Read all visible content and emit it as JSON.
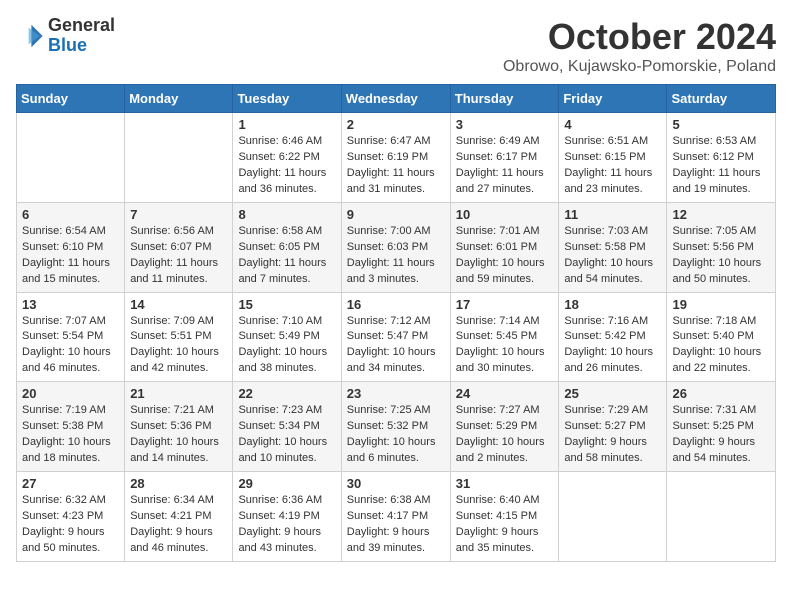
{
  "header": {
    "logo": {
      "general": "General",
      "blue": "Blue"
    },
    "title": "October 2024",
    "location": "Obrowo, Kujawsko-Pomorskie, Poland"
  },
  "days_of_week": [
    "Sunday",
    "Monday",
    "Tuesday",
    "Wednesday",
    "Thursday",
    "Friday",
    "Saturday"
  ],
  "weeks": [
    [
      {
        "day": "",
        "info": ""
      },
      {
        "day": "",
        "info": ""
      },
      {
        "day": "1",
        "info": "Sunrise: 6:46 AM\nSunset: 6:22 PM\nDaylight: 11 hours and 36 minutes."
      },
      {
        "day": "2",
        "info": "Sunrise: 6:47 AM\nSunset: 6:19 PM\nDaylight: 11 hours and 31 minutes."
      },
      {
        "day": "3",
        "info": "Sunrise: 6:49 AM\nSunset: 6:17 PM\nDaylight: 11 hours and 27 minutes."
      },
      {
        "day": "4",
        "info": "Sunrise: 6:51 AM\nSunset: 6:15 PM\nDaylight: 11 hours and 23 minutes."
      },
      {
        "day": "5",
        "info": "Sunrise: 6:53 AM\nSunset: 6:12 PM\nDaylight: 11 hours and 19 minutes."
      }
    ],
    [
      {
        "day": "6",
        "info": "Sunrise: 6:54 AM\nSunset: 6:10 PM\nDaylight: 11 hours and 15 minutes."
      },
      {
        "day": "7",
        "info": "Sunrise: 6:56 AM\nSunset: 6:07 PM\nDaylight: 11 hours and 11 minutes."
      },
      {
        "day": "8",
        "info": "Sunrise: 6:58 AM\nSunset: 6:05 PM\nDaylight: 11 hours and 7 minutes."
      },
      {
        "day": "9",
        "info": "Sunrise: 7:00 AM\nSunset: 6:03 PM\nDaylight: 11 hours and 3 minutes."
      },
      {
        "day": "10",
        "info": "Sunrise: 7:01 AM\nSunset: 6:01 PM\nDaylight: 10 hours and 59 minutes."
      },
      {
        "day": "11",
        "info": "Sunrise: 7:03 AM\nSunset: 5:58 PM\nDaylight: 10 hours and 54 minutes."
      },
      {
        "day": "12",
        "info": "Sunrise: 7:05 AM\nSunset: 5:56 PM\nDaylight: 10 hours and 50 minutes."
      }
    ],
    [
      {
        "day": "13",
        "info": "Sunrise: 7:07 AM\nSunset: 5:54 PM\nDaylight: 10 hours and 46 minutes."
      },
      {
        "day": "14",
        "info": "Sunrise: 7:09 AM\nSunset: 5:51 PM\nDaylight: 10 hours and 42 minutes."
      },
      {
        "day": "15",
        "info": "Sunrise: 7:10 AM\nSunset: 5:49 PM\nDaylight: 10 hours and 38 minutes."
      },
      {
        "day": "16",
        "info": "Sunrise: 7:12 AM\nSunset: 5:47 PM\nDaylight: 10 hours and 34 minutes."
      },
      {
        "day": "17",
        "info": "Sunrise: 7:14 AM\nSunset: 5:45 PM\nDaylight: 10 hours and 30 minutes."
      },
      {
        "day": "18",
        "info": "Sunrise: 7:16 AM\nSunset: 5:42 PM\nDaylight: 10 hours and 26 minutes."
      },
      {
        "day": "19",
        "info": "Sunrise: 7:18 AM\nSunset: 5:40 PM\nDaylight: 10 hours and 22 minutes."
      }
    ],
    [
      {
        "day": "20",
        "info": "Sunrise: 7:19 AM\nSunset: 5:38 PM\nDaylight: 10 hours and 18 minutes."
      },
      {
        "day": "21",
        "info": "Sunrise: 7:21 AM\nSunset: 5:36 PM\nDaylight: 10 hours and 14 minutes."
      },
      {
        "day": "22",
        "info": "Sunrise: 7:23 AM\nSunset: 5:34 PM\nDaylight: 10 hours and 10 minutes."
      },
      {
        "day": "23",
        "info": "Sunrise: 7:25 AM\nSunset: 5:32 PM\nDaylight: 10 hours and 6 minutes."
      },
      {
        "day": "24",
        "info": "Sunrise: 7:27 AM\nSunset: 5:29 PM\nDaylight: 10 hours and 2 minutes."
      },
      {
        "day": "25",
        "info": "Sunrise: 7:29 AM\nSunset: 5:27 PM\nDaylight: 9 hours and 58 minutes."
      },
      {
        "day": "26",
        "info": "Sunrise: 7:31 AM\nSunset: 5:25 PM\nDaylight: 9 hours and 54 minutes."
      }
    ],
    [
      {
        "day": "27",
        "info": "Sunrise: 6:32 AM\nSunset: 4:23 PM\nDaylight: 9 hours and 50 minutes."
      },
      {
        "day": "28",
        "info": "Sunrise: 6:34 AM\nSunset: 4:21 PM\nDaylight: 9 hours and 46 minutes."
      },
      {
        "day": "29",
        "info": "Sunrise: 6:36 AM\nSunset: 4:19 PM\nDaylight: 9 hours and 43 minutes."
      },
      {
        "day": "30",
        "info": "Sunrise: 6:38 AM\nSunset: 4:17 PM\nDaylight: 9 hours and 39 minutes."
      },
      {
        "day": "31",
        "info": "Sunrise: 6:40 AM\nSunset: 4:15 PM\nDaylight: 9 hours and 35 minutes."
      },
      {
        "day": "",
        "info": ""
      },
      {
        "day": "",
        "info": ""
      }
    ]
  ]
}
